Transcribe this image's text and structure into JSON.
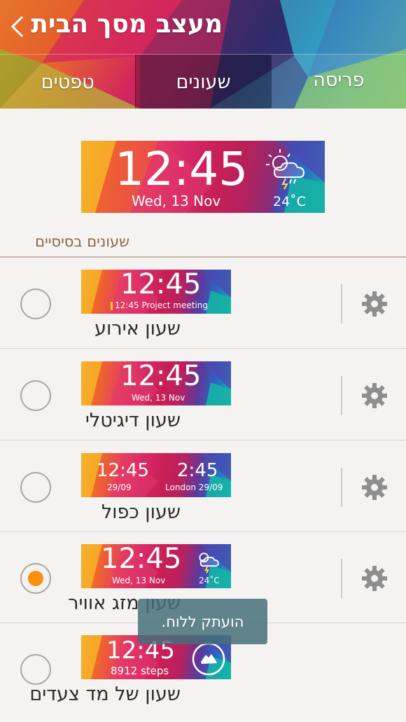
{
  "header": {
    "title": "מעצב מסך הבית",
    "tabs": [
      {
        "label": "פריסה"
      },
      {
        "label": "שעונים"
      },
      {
        "label": "טפטים"
      }
    ]
  },
  "preview": {
    "time": "12:45",
    "date": "Wed, 13 Nov",
    "temp": "24˚C",
    "weather_icon": "cloud-thunder-icon"
  },
  "section": {
    "title": "שעונים בסיסיים"
  },
  "clocks": [
    {
      "label": "שעון אירוע",
      "time": "12:45",
      "sub": "12:45 Project meeting",
      "selected": false
    },
    {
      "label": "שעון דיגיטלי",
      "time": "12:45",
      "sub": "Wed, 13 Nov",
      "selected": false
    },
    {
      "label": "שעון כפול",
      "time_left": "12:45",
      "date_left": "29/09",
      "time_right": "2:45",
      "date_right": "London 29/09",
      "selected": false
    },
    {
      "label": "שעון מזג אוויר",
      "time": "12:45",
      "date": "Wed, 13 Nov",
      "temp": "24˚C",
      "selected": true
    },
    {
      "label": "שעון של מד צעדים",
      "time": "12:45",
      "steps": "8912 steps",
      "selected": false
    }
  ],
  "toast": {
    "text": "הועתק ללוח."
  },
  "colors": {
    "accent": "#f78f10",
    "section_title": "#8a6640"
  }
}
